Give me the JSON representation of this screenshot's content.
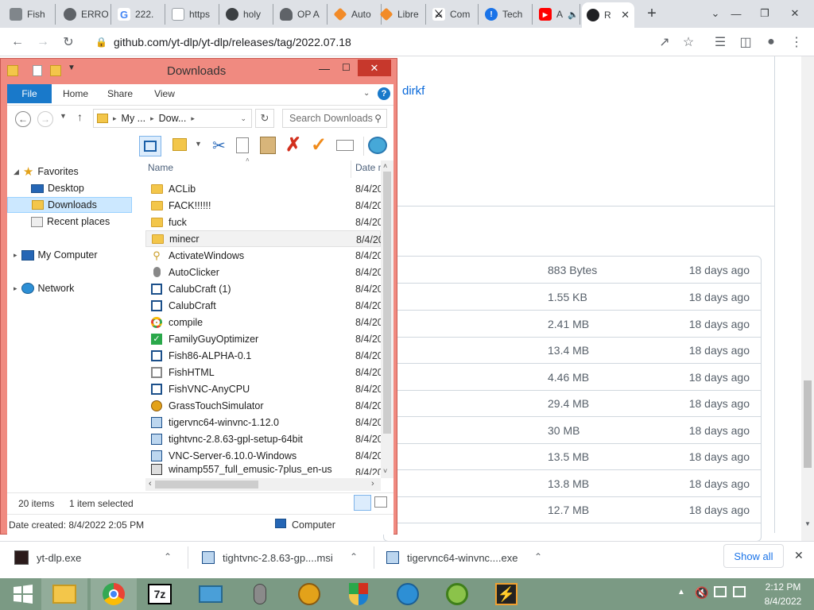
{
  "browser": {
    "tabs": [
      {
        "label": "Fish",
        "icon": "document-icon",
        "color": "#5f6368"
      },
      {
        "label": "ERRO",
        "icon": "globe-icon",
        "color": "#5f6368"
      },
      {
        "label": "222.",
        "icon": "google-icon",
        "color": "#4285f4"
      },
      {
        "label": "https",
        "icon": "page-icon",
        "color": "#5f6368"
      },
      {
        "label": "holy",
        "icon": "globe-icon",
        "color": "#5f6368"
      },
      {
        "label": "OP A",
        "icon": "shield-icon",
        "color": "#5f6368"
      },
      {
        "label": "Auto",
        "icon": "diamond-icon",
        "color": "#f28b28"
      },
      {
        "label": "Libre",
        "icon": "diamond-icon",
        "color": "#f28b28"
      },
      {
        "label": "Com",
        "icon": "sword-icon",
        "color": "#202124"
      },
      {
        "label": "Tech",
        "icon": "alert-icon",
        "color": "#1a73e8"
      },
      {
        "label": "A",
        "icon": "youtube-icon",
        "color": "#ff0000"
      },
      {
        "label": "R",
        "icon": "github-icon",
        "color": "#202124",
        "active": true
      }
    ],
    "new_tab": "+",
    "url": "github.com/yt-dlp/yt-dlp/releases/tag/2022.07.18"
  },
  "page": {
    "author": "dirkf",
    "assets": [
      {
        "size": "883 Bytes",
        "date": "18 days ago"
      },
      {
        "size": "1.55 KB",
        "date": "18 days ago"
      },
      {
        "size": "2.41 MB",
        "date": "18 days ago"
      },
      {
        "size": "13.4 MB",
        "date": "18 days ago"
      },
      {
        "size": "4.46 MB",
        "date": "18 days ago"
      },
      {
        "size": "29.4 MB",
        "date": "18 days ago"
      },
      {
        "size": "30 MB",
        "date": "18 days ago"
      },
      {
        "size": "13.5 MB",
        "date": "18 days ago"
      },
      {
        "size": "13.8 MB",
        "date": "18 days ago"
      },
      {
        "size": "12.7 MB",
        "date": "18 days ago"
      }
    ]
  },
  "explorer": {
    "title": "Downloads",
    "ribbon_tabs": [
      "File",
      "Home",
      "Share",
      "View"
    ],
    "breadcrumb": [
      "My ...",
      "Dow..."
    ],
    "search_placeholder": "Search Downloads",
    "nav_tree": {
      "favorites": "Favorites",
      "desktop": "Desktop",
      "downloads": "Downloads",
      "recent": "Recent places",
      "computer": "My Computer",
      "network": "Network"
    },
    "columns": {
      "name": "Name",
      "date": "Date m"
    },
    "files": [
      {
        "name": "ACLib",
        "date": "8/4/20",
        "icon": "folder-icon"
      },
      {
        "name": "FACK!!!!!!",
        "date": "8/4/20",
        "icon": "folder-icon"
      },
      {
        "name": "fuck",
        "date": "8/4/20",
        "icon": "folder-icon"
      },
      {
        "name": "minecr",
        "date": "8/4/20",
        "icon": "folder-icon"
      },
      {
        "name": "ActivateWindows",
        "date": "8/4/20",
        "icon": "key-icon"
      },
      {
        "name": "AutoClicker",
        "date": "8/4/20",
        "icon": "mouse-icon"
      },
      {
        "name": "CalubCraft (1)",
        "date": "8/4/20",
        "icon": "app-icon"
      },
      {
        "name": "CalubCraft",
        "date": "8/4/20",
        "icon": "app-icon"
      },
      {
        "name": "compile",
        "date": "8/4/20",
        "icon": "chrome-icon"
      },
      {
        "name": "FamilyGuyOptimizer",
        "date": "8/4/20",
        "icon": "checkmark-icon"
      },
      {
        "name": "Fish86-ALPHA-0.1",
        "date": "8/4/20",
        "icon": "app-icon"
      },
      {
        "name": "FishHTML",
        "date": "8/4/20",
        "icon": "app-icon"
      },
      {
        "name": "FishVNC-AnyCPU",
        "date": "8/4/20",
        "icon": "app-icon"
      },
      {
        "name": "GrassTouchSimulator",
        "date": "8/4/20",
        "icon": "glasses-icon"
      },
      {
        "name": "tigervnc64-winvnc-1.12.0",
        "date": "8/4/20",
        "icon": "installer-icon"
      },
      {
        "name": "tightvnc-2.8.63-gpl-setup-64bit",
        "date": "8/4/20",
        "icon": "installer-icon"
      },
      {
        "name": "VNC-Server-6.10.0-Windows",
        "date": "8/4/20",
        "icon": "installer-icon"
      },
      {
        "name": "winamp557_full_emusic-7plus_en-us",
        "date": "8/4/20",
        "icon": "installer-icon"
      }
    ],
    "status": {
      "count": "20 items",
      "selected": "1 item selected",
      "created": "Date created: 8/4/2022 2:05 PM",
      "location": "Computer"
    }
  },
  "downloads_shelf": {
    "items": [
      {
        "name": "yt-dlp.exe"
      },
      {
        "name": "tightvnc-2.8.63-gp....msi"
      },
      {
        "name": "tigervnc64-winvnc....exe"
      }
    ],
    "show_all": "Show all"
  },
  "taskbar": {
    "time": "2:12 PM",
    "date": "8/4/2022"
  }
}
